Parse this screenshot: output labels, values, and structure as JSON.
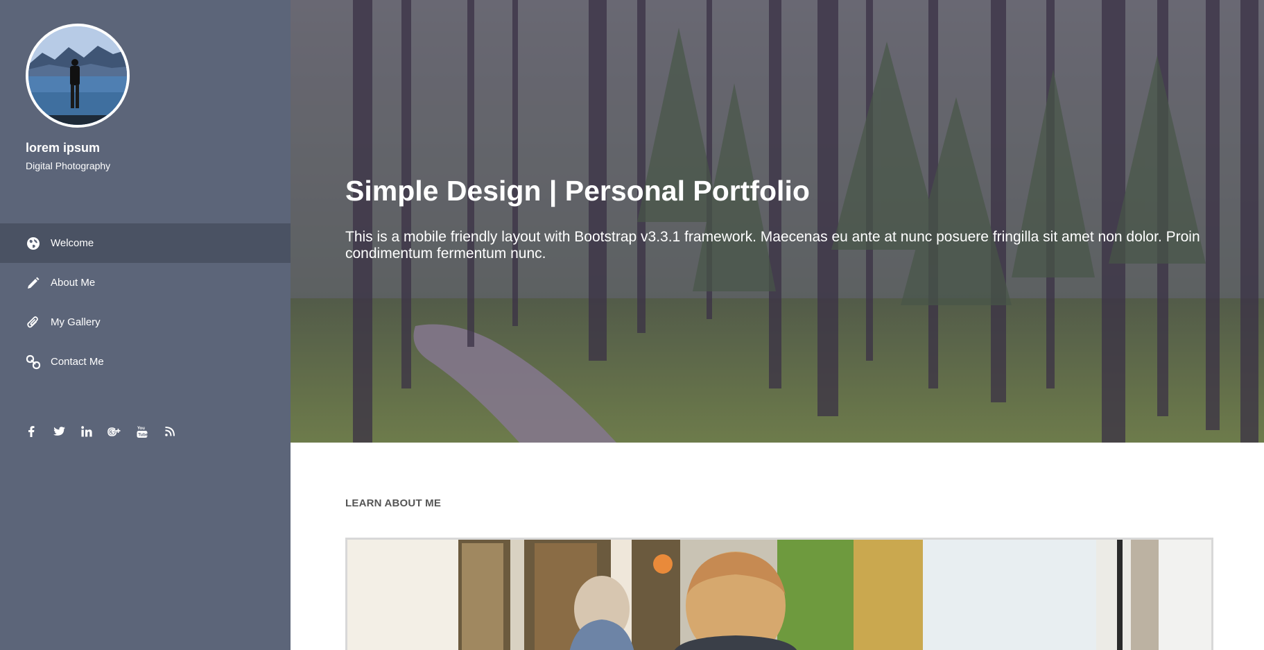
{
  "profile": {
    "name": "lorem ipsum",
    "subtitle": "Digital Photography"
  },
  "nav": {
    "items": [
      {
        "label": "Welcome",
        "icon": "globe-icon",
        "active": true
      },
      {
        "label": "About Me",
        "icon": "pencil-icon",
        "active": false
      },
      {
        "label": "My Gallery",
        "icon": "paperclip-icon",
        "active": false
      },
      {
        "label": "Contact Me",
        "icon": "link-icon",
        "active": false
      }
    ]
  },
  "social": {
    "icons": [
      "facebook-icon",
      "twitter-icon",
      "linkedin-icon",
      "google-plus-icon",
      "youtube-icon",
      "rss-icon"
    ]
  },
  "hero": {
    "title": "Simple Design | Personal Portfolio",
    "text": "This is a mobile friendly layout with Bootstrap v3.3.1 framework. Maecenas eu ante at nunc posuere fringilla sit amet non dolor. Proin condimentum fermentum nunc."
  },
  "about": {
    "section_title": "LEARN ABOUT ME"
  },
  "colors": {
    "sidebar": "#5c6579",
    "sidebar_active": "#4a5263",
    "text_light": "#ffffff",
    "heading_dark": "#555555"
  }
}
